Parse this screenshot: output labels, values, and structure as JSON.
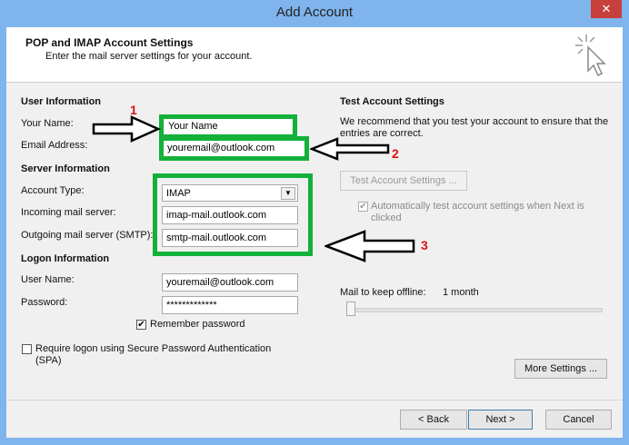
{
  "window": {
    "title": "Add Account",
    "close_icon": "close-icon"
  },
  "header": {
    "title": "POP and IMAP Account Settings",
    "subtitle": "Enter the mail server settings for your account."
  },
  "user_info": {
    "section": "User Information",
    "name_label": "Your Name:",
    "name_value": "Your Name",
    "email_label": "Email Address:",
    "email_value": "youremail@outlook.com"
  },
  "server_info": {
    "section": "Server Information",
    "type_label": "Account Type:",
    "type_value": "IMAP",
    "incoming_label": "Incoming mail server:",
    "incoming_value": "imap-mail.outlook.com",
    "outgoing_label": "Outgoing mail server (SMTP):",
    "outgoing_value": "smtp-mail.outlook.com"
  },
  "logon_info": {
    "section": "Logon Information",
    "user_label": "User Name:",
    "user_value": "youremail@outlook.com",
    "password_label": "Password:",
    "password_value": "*************",
    "remember_label": "Remember password",
    "spa_label": "Require logon using Secure Password Authentication (SPA)"
  },
  "test": {
    "section": "Test Account Settings",
    "description": "We recommend that you test your account to ensure that the entries are correct.",
    "button": "Test Account Settings ...",
    "auto_label": "Automatically test account settings when Next is clicked"
  },
  "offline": {
    "label": "Mail to keep offline:",
    "value": "1 month"
  },
  "buttons": {
    "more": "More Settings ...",
    "back": "< Back",
    "next": "Next >",
    "cancel": "Cancel"
  },
  "annotations": {
    "n1": "1",
    "n2": "2",
    "n3": "3"
  },
  "colors": {
    "highlight": "#13b13a",
    "annotation": "#dd1111",
    "titlebar": "#7fb4ec"
  }
}
